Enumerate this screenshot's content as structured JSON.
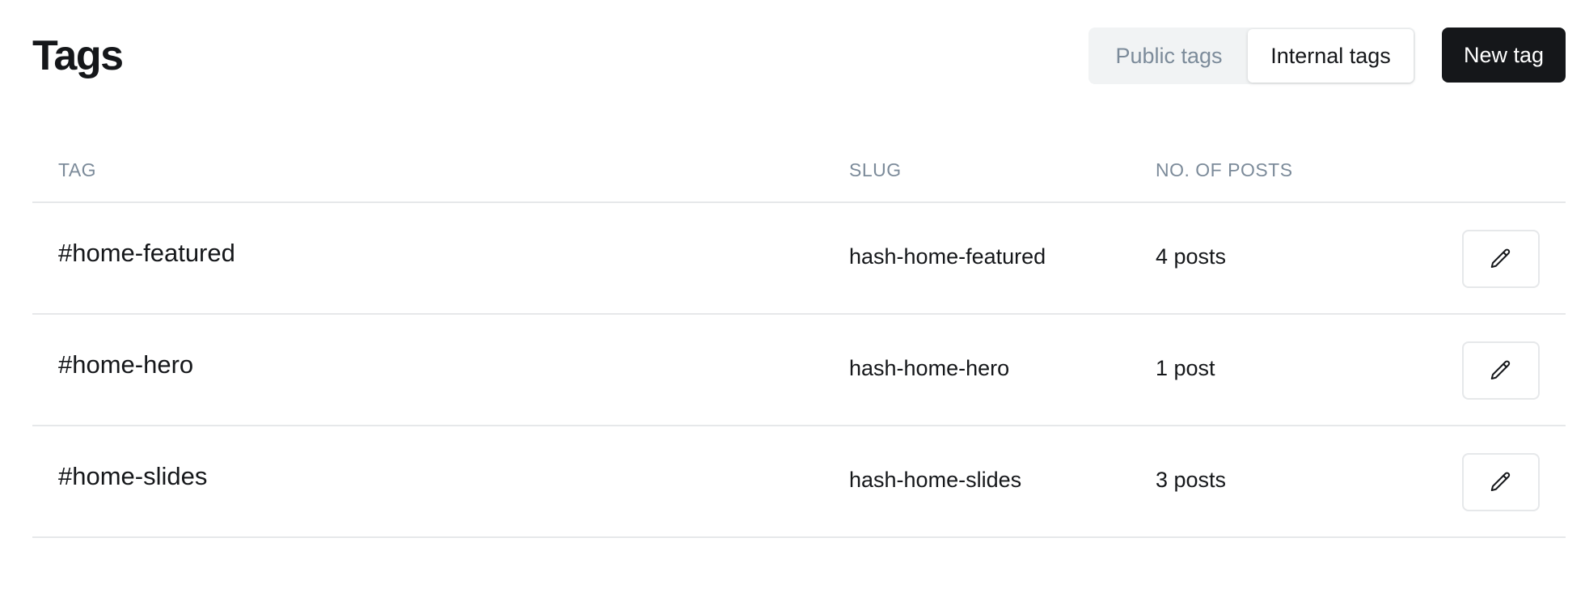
{
  "header": {
    "title": "Tags",
    "tabs": [
      {
        "label": "Public tags",
        "active": false
      },
      {
        "label": "Internal tags",
        "active": true
      }
    ],
    "new_tag_label": "New tag"
  },
  "table": {
    "columns": {
      "tag": "TAG",
      "slug": "SLUG",
      "posts": "NO. OF POSTS"
    },
    "rows": [
      {
        "name": "#home-featured",
        "slug": "hash-home-featured",
        "posts": "4 posts",
        "action_icon": "pencil-icon"
      },
      {
        "name": "#home-hero",
        "slug": "hash-home-hero",
        "posts": "1 post",
        "action_icon": "pencil-icon"
      },
      {
        "name": "#home-slides",
        "slug": "hash-home-slides",
        "posts": "3 posts",
        "action_icon": "pencil-icon"
      }
    ]
  },
  "colors": {
    "primary_button": "#15171a",
    "muted_text": "#7c8b9a",
    "divider": "#e6e8ea",
    "segment_bg": "#f1f3f4"
  }
}
